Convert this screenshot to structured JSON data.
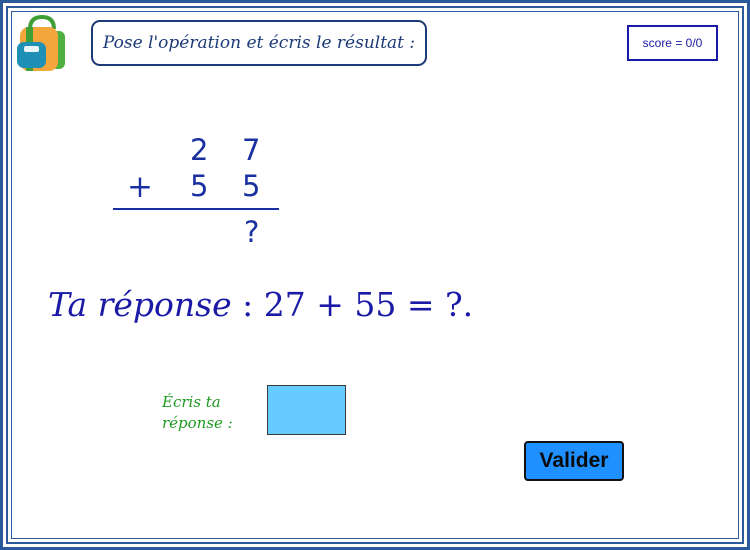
{
  "header": {
    "instruction": "Pose l'opération et écris le résultat :",
    "score": "score = 0/0",
    "icon": "backpack-icon"
  },
  "operation": {
    "row1": [
      "2",
      "7"
    ],
    "operator": "+",
    "row2": [
      "5",
      "5"
    ],
    "result_placeholder": "?"
  },
  "answer_line": {
    "label": "Ta réponse",
    "expression": ": 27 + 55 =  ?."
  },
  "prompt": {
    "label_line1": "Écris ta",
    "label_line2": "réponse :"
  },
  "input": {
    "value": "",
    "placeholder": ""
  },
  "button": {
    "label": "Valider"
  },
  "colors": {
    "frame": "#2a5a9a",
    "text_blue": "#1a2fa0",
    "prompt_green": "#1f9a1f",
    "input_bg": "#66ccff",
    "button_bg": "#1e90ff"
  }
}
